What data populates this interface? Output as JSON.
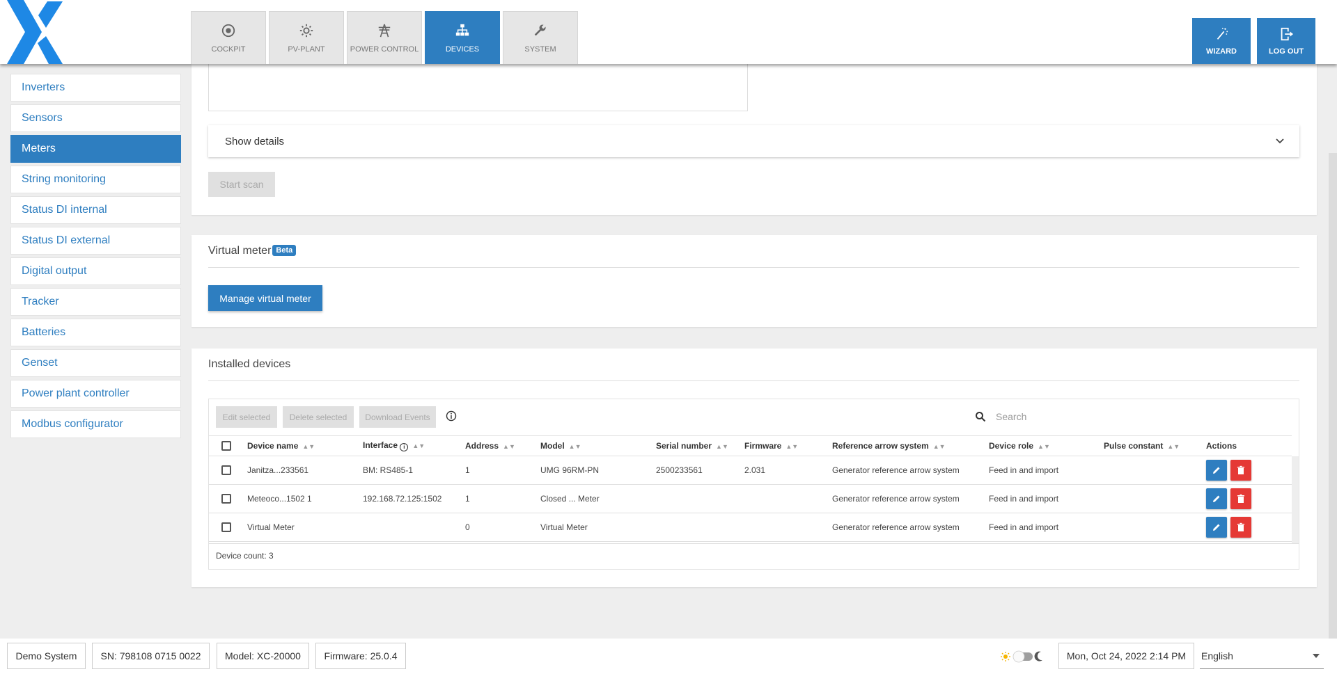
{
  "tabs": [
    {
      "label": "COCKPIT",
      "icon": "cockpit-icon"
    },
    {
      "label": "PV-PLANT",
      "icon": "sun-icon"
    },
    {
      "label": "POWER CONTROL",
      "icon": "power-tower-icon"
    },
    {
      "label": "DEVICES",
      "icon": "devices-icon",
      "active": true
    },
    {
      "label": "SYSTEM",
      "icon": "wrench-icon"
    }
  ],
  "header": {
    "wizard_label": "WIZARD",
    "logout_label": "LOG OUT"
  },
  "sidebar": {
    "items": [
      {
        "label": "Inverters"
      },
      {
        "label": "Sensors"
      },
      {
        "label": "Meters",
        "active": true
      },
      {
        "label": "String monitoring"
      },
      {
        "label": "Status DI internal"
      },
      {
        "label": "Status DI external"
      },
      {
        "label": "Digital output"
      },
      {
        "label": "Tracker"
      },
      {
        "label": "Batteries"
      },
      {
        "label": "Genset"
      },
      {
        "label": "Power plant controller"
      },
      {
        "label": "Modbus configurator"
      }
    ]
  },
  "scan_panel": {
    "show_details": "Show details",
    "start_scan": "Start scan"
  },
  "virtual_meter": {
    "title": "Virtual meter",
    "badge": "Beta",
    "manage_button": "Manage virtual meter"
  },
  "installed": {
    "title": "Installed devices",
    "toolbar": {
      "edit_selected": "Edit selected",
      "delete_selected": "Delete selected",
      "download_events": "Download Events"
    },
    "search_placeholder": "Search",
    "columns": {
      "device_name": "Device name",
      "interface": "Interface",
      "address": "Address",
      "model": "Model",
      "serial": "Serial number",
      "firmware": "Firmware",
      "reference": "Reference arrow system",
      "role": "Device role",
      "pulse": "Pulse constant",
      "actions": "Actions"
    },
    "rows": [
      {
        "name": "Janitza...233561",
        "interface": "BM: RS485-1",
        "address": "1",
        "model": "UMG 96RM-PN",
        "serial": "2500233561",
        "firmware": "2.031",
        "reference": "Generator reference arrow system",
        "role": "Feed in and import",
        "pulse": ""
      },
      {
        "name": "Meteoco...1502 1",
        "interface": "192.168.72.125:1502",
        "address": "1",
        "model": "Closed ... Meter",
        "serial": "",
        "firmware": "",
        "reference": "Generator reference arrow system",
        "role": "Feed in and import",
        "pulse": ""
      },
      {
        "name": "Virtual Meter",
        "interface": "",
        "address": "0",
        "model": "Virtual Meter",
        "serial": "",
        "firmware": "",
        "reference": "Generator reference arrow system",
        "role": "Feed in and import",
        "pulse": ""
      }
    ],
    "device_count": "Device count: 3"
  },
  "footer": {
    "system": "Demo System",
    "sn": "SN: 798108 0715 0022",
    "model": "Model: XC-20000",
    "firmware": "Firmware: 25.0.4",
    "datetime": "Mon, Oct 24, 2022 2:14 PM",
    "language": "English"
  },
  "colors": {
    "accent": "#2e7ec0",
    "danger": "#e53935",
    "logo": "#1e88e5",
    "sun": "#f5b400"
  }
}
